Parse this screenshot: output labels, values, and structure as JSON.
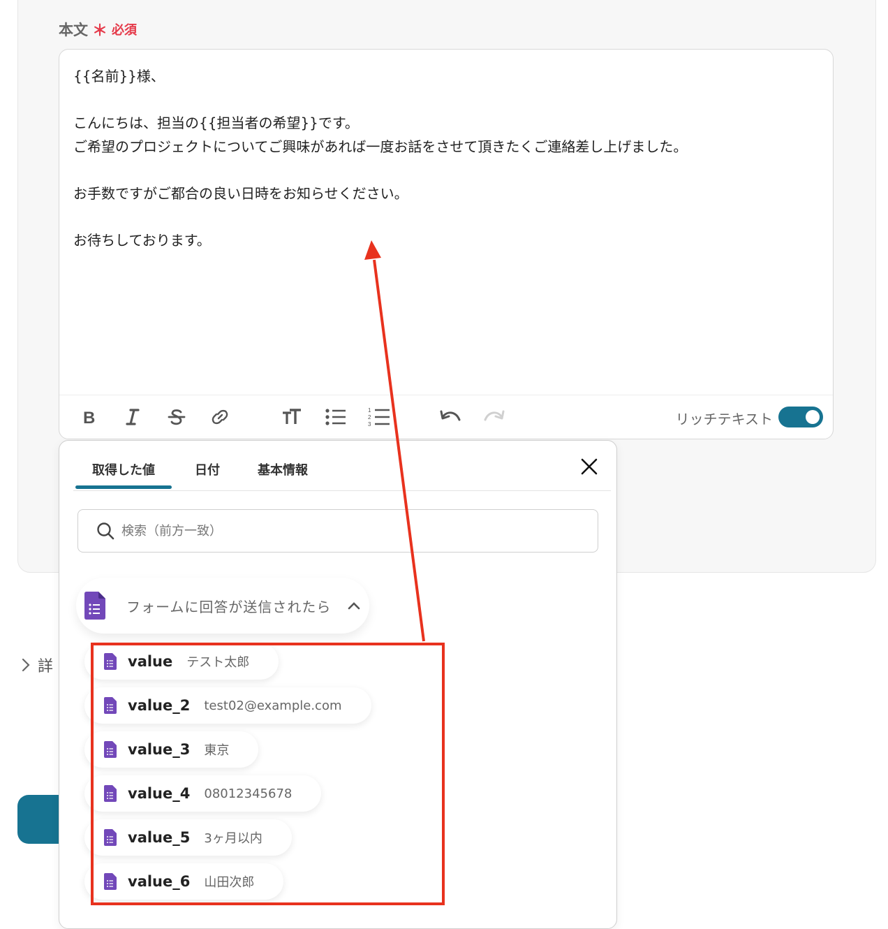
{
  "field": {
    "label": "本文",
    "required_mark": "＊",
    "required_text": "必須"
  },
  "editor": {
    "lines": [
      "{{名前}}様、",
      "",
      "こんにちは、担当の{{担当者の希望}}です。",
      "ご希望のプロジェクトについてご興味があれば一度お話をさせて頂きたくご連絡差し上げました。",
      "",
      "お手数ですがご都合の良い日時をお知らせください。",
      "",
      "お待ちしております。"
    ],
    "rich_text_label": "リッチテキスト",
    "rich_text_enabled": true
  },
  "side": {
    "detail_label": "詳"
  },
  "popup": {
    "tabs": [
      {
        "label": "取得した値",
        "active": true
      },
      {
        "label": "日付",
        "active": false
      },
      {
        "label": "基本情報",
        "active": false
      }
    ],
    "search_placeholder": "検索（前方一致）",
    "section_title": "フォームに回答が送信されたら",
    "items": [
      {
        "key": "value",
        "value": "テスト太郎"
      },
      {
        "key": "value_2",
        "value": "test02@example.com"
      },
      {
        "key": "value_3",
        "value": "東京"
      },
      {
        "key": "value_4",
        "value": "08012345678"
      },
      {
        "key": "value_5",
        "value": "3ヶ月以内"
      },
      {
        "key": "value_6",
        "value": "山田次郎"
      }
    ]
  },
  "colors": {
    "accent": "#177391",
    "required": "#e53a4a",
    "annotation": "#e8321e",
    "form_icon": "#7248b9"
  }
}
